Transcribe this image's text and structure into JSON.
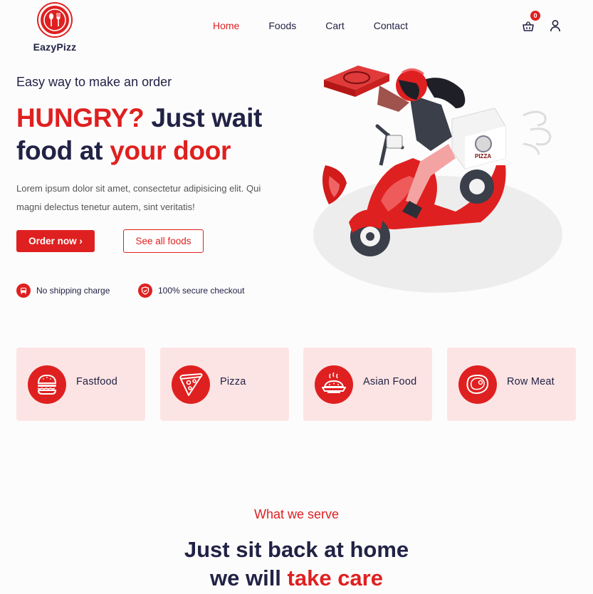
{
  "brand": {
    "name": "EazyPizz",
    "color": "#df2020",
    "icon": "spoon-fork-logo-icon"
  },
  "nav": {
    "items": [
      "Home",
      "Foods",
      "Cart",
      "Contact"
    ],
    "active": "Home"
  },
  "cart": {
    "count": "0",
    "icon": "basket-icon"
  },
  "user": {
    "icon": "user-icon"
  },
  "hero": {
    "subtitle": "Easy way to make an order",
    "title_line1_red": "HUNGRY?",
    "title_line1_dark": " Just wait",
    "title_line2_dark": "food at ",
    "title_line2_red": "your door",
    "description": "Lorem ipsum dolor sit amet, consectetur adipisicing elit. Qui magni delectus tenetur autem, sint veritatis!",
    "order_button": "Order now ›",
    "foods_button": "See all foods",
    "perks": [
      {
        "icon": "car-icon",
        "label": "No shipping charge"
      },
      {
        "icon": "shield-check-icon",
        "label": "100% secure checkout"
      }
    ],
    "illustration": "pizza-delivery-scooter-illustration"
  },
  "categories": [
    {
      "label": "Fastfood",
      "icon": "burger-icon"
    },
    {
      "label": "Pizza",
      "icon": "pizza-slice-icon"
    },
    {
      "label": "Asian Food",
      "icon": "asian-dish-icon"
    },
    {
      "label": "Row Meat",
      "icon": "meat-steak-icon"
    }
  ],
  "serve": {
    "tag": "What we serve",
    "title_line1": "Just sit back at home",
    "title_line2_dark": "we will ",
    "title_line2_red": "take care"
  },
  "colors": {
    "accent": "#df2020",
    "dark": "#212245",
    "category_bg": "#fde4e4"
  }
}
